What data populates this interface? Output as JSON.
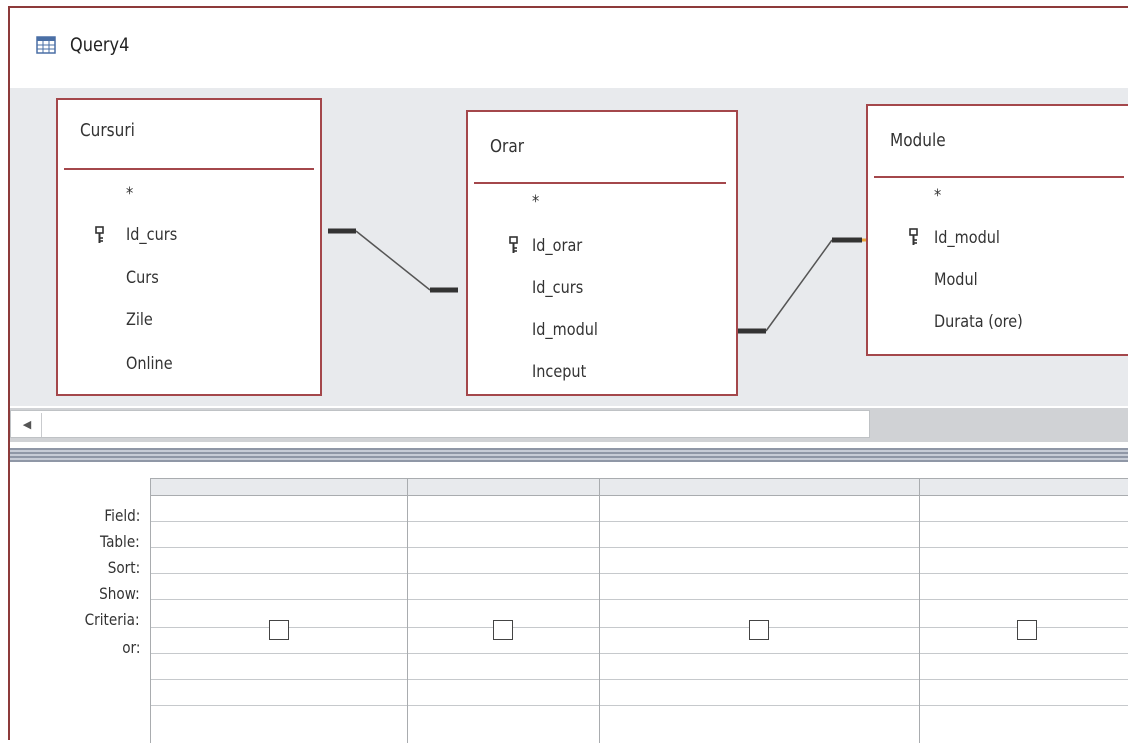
{
  "window": {
    "title": "Query4",
    "icon": "query-design-icon",
    "accent": "#a4474b"
  },
  "tables": [
    {
      "name": "Cursuri",
      "all_fields": "*",
      "fields": [
        {
          "label": "Id_curs",
          "primary_key": true
        },
        {
          "label": "Curs",
          "primary_key": false
        },
        {
          "label": "Zile",
          "primary_key": false
        },
        {
          "label": "Online",
          "primary_key": false
        }
      ]
    },
    {
      "name": "Orar",
      "all_fields": "*",
      "fields": [
        {
          "label": "Id_orar",
          "primary_key": true
        },
        {
          "label": "Id_curs",
          "primary_key": false
        },
        {
          "label": "Id_modul",
          "primary_key": false
        },
        {
          "label": "Inceput",
          "primary_key": false
        }
      ]
    },
    {
      "name": "Module",
      "all_fields": "*",
      "fields": [
        {
          "label": "Id_modul",
          "primary_key": true
        },
        {
          "label": "Modul",
          "primary_key": false
        },
        {
          "label": "Durata (ore)",
          "primary_key": false
        }
      ]
    }
  ],
  "relationships": [
    {
      "from": "Cursuri.Id_curs",
      "to": "Orar.Id_curs"
    },
    {
      "from": "Orar.Id_modul",
      "to": "Module.Id_modul"
    }
  ],
  "grid": {
    "row_labels": [
      "Field:",
      "Table:",
      "Sort:",
      "Show:",
      "Criteria:",
      "or:"
    ],
    "columns": [
      {
        "field": "",
        "table": "",
        "sort": "",
        "show": false,
        "criteria": "",
        "or": ""
      },
      {
        "field": "",
        "table": "",
        "sort": "",
        "show": false,
        "criteria": "",
        "or": ""
      },
      {
        "field": "",
        "table": "",
        "sort": "",
        "show": false,
        "criteria": "",
        "or": ""
      },
      {
        "field": "",
        "table": "",
        "sort": "",
        "show": false,
        "criteria": "",
        "or": ""
      }
    ]
  },
  "scrollbar": {
    "left_arrow": "◀"
  }
}
